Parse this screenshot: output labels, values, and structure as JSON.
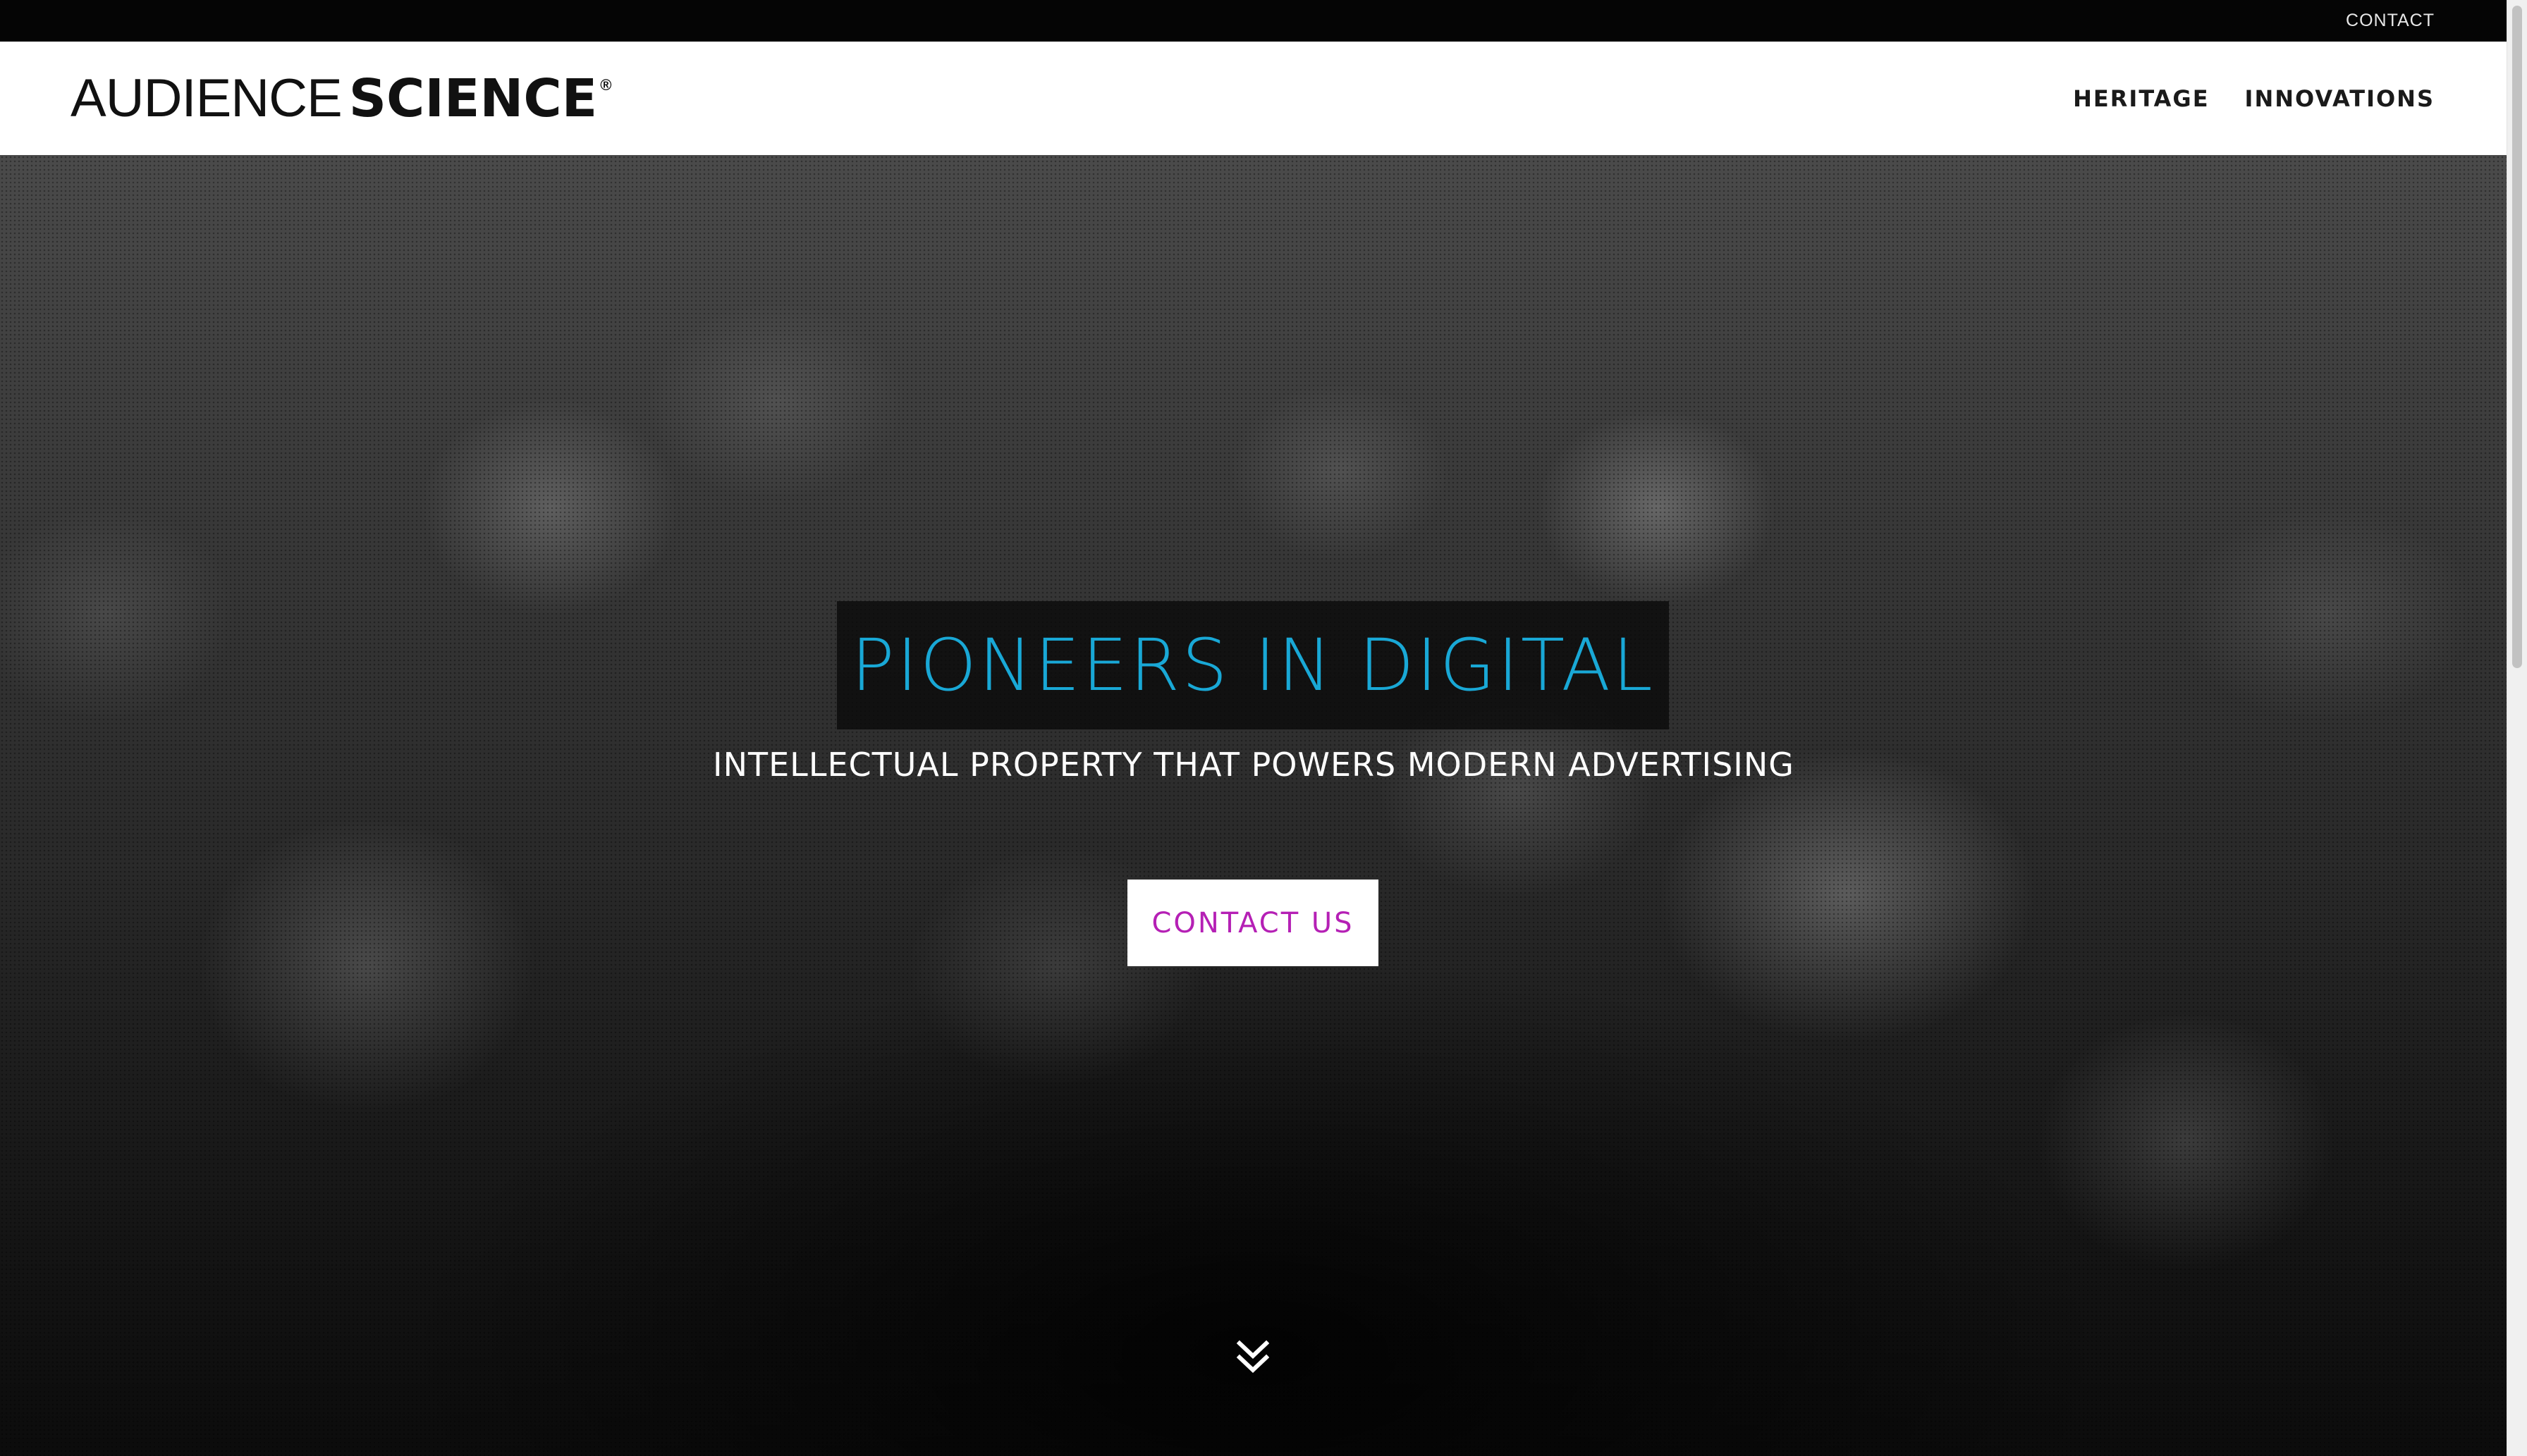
{
  "topbar": {
    "contact_label": "CONTACT"
  },
  "header": {
    "logo_light": "AUDIENCE",
    "logo_bold": "SCIENCE",
    "logo_mark": "®",
    "nav": [
      {
        "label": "HERITAGE"
      },
      {
        "label": "INNOVATIONS"
      }
    ]
  },
  "hero": {
    "headline": "PIONEERS IN DIGITAL",
    "subheadline": "INTELLECTUAL PROPERTY THAT POWERS MODERN ADVERTISING",
    "cta_label": "CONTACT US",
    "scroll_icon": "double-chevron-down-icon"
  },
  "colors": {
    "headline": "#19a8d6",
    "cta_text": "#b520b5",
    "topbar_bg": "#050505",
    "header_bg": "#ffffff"
  }
}
